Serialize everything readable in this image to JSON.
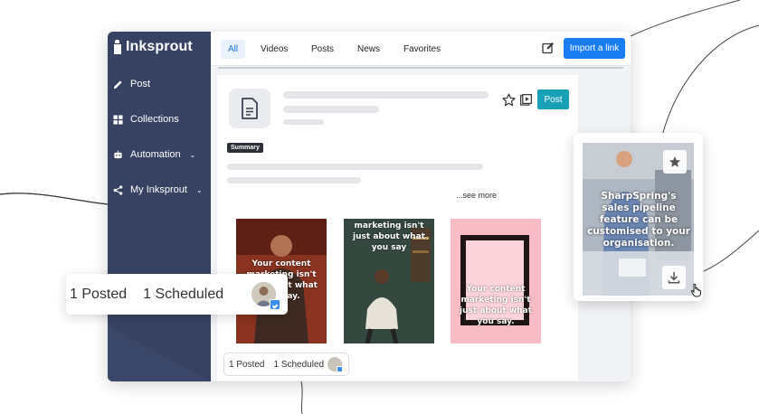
{
  "app": {
    "brand": "Inksprout",
    "sidebar": {
      "items": [
        {
          "label": "Post",
          "icon": "pencil-icon"
        },
        {
          "label": "Collections",
          "icon": "grid-icon"
        },
        {
          "label": "Automation",
          "icon": "robot-icon",
          "chevron": "⌄"
        },
        {
          "label": "My Inksprout",
          "icon": "share-icon",
          "chevron": "⌄"
        }
      ]
    },
    "tabs": [
      {
        "label": "All",
        "active": true
      },
      {
        "label": "Videos"
      },
      {
        "label": "Posts"
      },
      {
        "label": "News"
      },
      {
        "label": "Favorites"
      }
    ],
    "import_label": "Import a link",
    "card": {
      "post_label": "Post",
      "summary_label": "Summary",
      "see_more": "...see more"
    },
    "thumbnails": [
      {
        "text": "Your content marketing isn't just about what you say."
      },
      {
        "text": "marketing isn't just about what you say"
      },
      {
        "text": "Your content marketing isn't just about what you say."
      }
    ],
    "status_small": {
      "posted": "1 Posted",
      "scheduled": "1 Scheduled"
    }
  },
  "status_large": {
    "posted": "1 Posted",
    "scheduled": "1 Scheduled"
  },
  "floating_card": {
    "text": "SharpSpring's sales pipeline feature can be customised to your organisation."
  },
  "colors": {
    "sidebar": "#374262",
    "primary": "#1a7ef2",
    "post_button": "#18a0b7",
    "summary_badge": "#2c2f36",
    "pink_thumb": "#f8bcc6"
  }
}
